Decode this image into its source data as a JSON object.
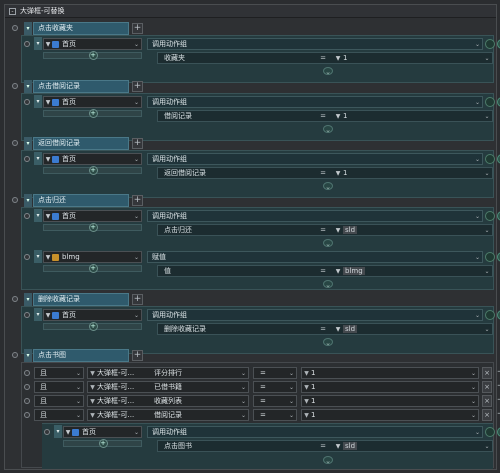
{
  "window": {
    "title": "大弹框-可替换",
    "collapse_glyph": "-"
  },
  "groups": [
    {
      "label": "点击收藏夹",
      "items": [
        {
          "type": "call",
          "target": "首页",
          "action": "调用动作组",
          "param_name": "收藏夹",
          "op": "=",
          "param_value": "1"
        }
      ]
    },
    {
      "label": "点击借阅记录",
      "items": [
        {
          "type": "call",
          "target": "首页",
          "action": "调用动作组",
          "param_name": "借阅记录",
          "op": "=",
          "param_value": "1"
        }
      ]
    },
    {
      "label": "返回借阅记录",
      "items": [
        {
          "type": "call",
          "target": "首页",
          "action": "调用动作组",
          "param_name": "返回借阅记录",
          "op": "=",
          "param_value": "1"
        }
      ]
    },
    {
      "label": "点击归还",
      "items": [
        {
          "type": "call",
          "target": "首页",
          "action": "调用动作组",
          "param_name": "点击归还",
          "op": "=",
          "param_value": "sld"
        },
        {
          "type": "assign",
          "target": "blmg",
          "action": "赋值",
          "param_name": "值",
          "op": "=",
          "param_value": "blmg"
        }
      ]
    },
    {
      "label": "删除收藏记录",
      "items": [
        {
          "type": "call",
          "target": "首页",
          "action": "调用动作组",
          "param_name": "删除收藏记录",
          "op": "=",
          "param_value": "sld"
        }
      ]
    },
    {
      "label": "点击书图",
      "conditions": [
        {
          "logic": "且",
          "target": "大弹框-可...",
          "field": "评分排行",
          "op": "=",
          "value": "1"
        },
        {
          "logic": "且",
          "target": "大弹框-可...",
          "field": "已借书籍",
          "op": "=",
          "value": "1"
        },
        {
          "logic": "且",
          "target": "大弹框-可...",
          "field": "收藏列表",
          "op": "=",
          "value": "1"
        },
        {
          "logic": "且",
          "target": "大弹框-可...",
          "field": "借阅记录",
          "op": "=",
          "value": "1"
        }
      ],
      "items": [
        {
          "type": "call",
          "target": "首页",
          "action": "调用动作组",
          "param_name": "点击图书",
          "op": "=",
          "param_value": "sld"
        }
      ]
    }
  ],
  "colors": {
    "group_header": "#2f5a6c",
    "body_bg": "#253b3f",
    "accent_green": "#4c8f7a"
  },
  "icons": {
    "page_icon": "blue-page-icon",
    "var_icon": "orange-variable-icon"
  }
}
